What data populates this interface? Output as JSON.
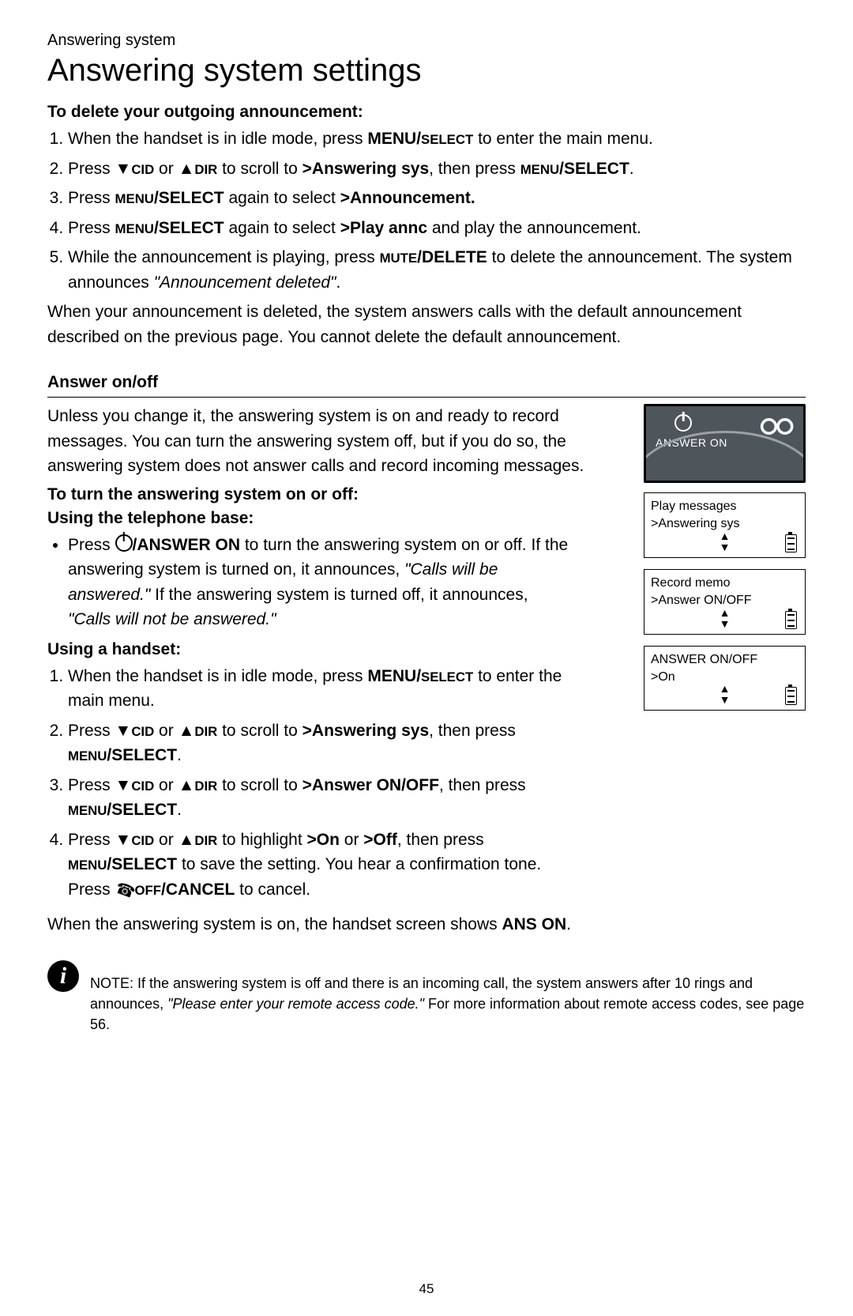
{
  "header": {
    "section": "Answering system"
  },
  "title": "Answering system settings",
  "delete": {
    "heading": "To delete your outgoing announcement:",
    "s1a": "When the handset is in idle mode, press ",
    "s1b": "MENU/",
    "s1c": "SELECT",
    "s1d": " to enter the main menu.",
    "s2a": "Press ",
    "s2down": "▼",
    "s2cid": "CID",
    "s2or": " or ",
    "s2up": "▲",
    "s2dir": "DIR",
    "s2b": " to scroll to ",
    "s2c": ">Answering sys",
    "s2d": ", then press ",
    "s2e": "MENU",
    "s2f": "/SELECT",
    "s2g": ".",
    "s3a": "Press ",
    "s3b": "MENU",
    "s3c": "/SELECT",
    "s3d": " again to select ",
    "s3e": ">Announcement.",
    "s4a": "Press ",
    "s4b": "MENU",
    "s4c": "/SELECT",
    "s4d": " again to select ",
    "s4e": ">Play annc",
    "s4f": " and play the announcement.",
    "s5a": "While the announcement is playing, press ",
    "s5b": "MUTE",
    "s5c": "/DELETE",
    "s5d": " to delete the announcement. The system announces ",
    "s5e": "\"Announcement deleted\"",
    "s5f": ".",
    "after": "When your announcement is deleted, the system answers calls with the default announcement described on the previous page. You cannot delete the default announcement."
  },
  "answer": {
    "heading": "Answer on/off",
    "intro": "Unless you change it, the answering system is on and ready to record messages. You can turn the answering system off, but if you do so, the answering system does not answer calls and record incoming messages.",
    "turn_heading": "To turn the answering system on or off:",
    "base_heading": "Using the telephone base:",
    "b1a": "Press ",
    "b1b": "/ANSWER ON",
    "b1c": " to turn the answering system on or off. If the answering system is turned on, it announces, ",
    "b1d": "\"Calls will be answered.\"",
    "b1e": " If the answering system is turned off, it announces, ",
    "b1f": "\"Calls will not be answered.\"",
    "hs_heading": "Using a handset:",
    "h1a": "When the handset is in idle mode, press ",
    "h1b": "MENU/",
    "h1c": "SELECT",
    "h1d": " to enter the main menu.",
    "h2a": "Press ",
    "h2b": " to scroll to ",
    "h2c": ">Answering sys",
    "h2d": ", then press ",
    "h2e": "MENU",
    "h2f": "/SELECT",
    "h2g": ".",
    "h3a": "Press ",
    "h3b": " to scroll to ",
    "h3c": ">Answer ON/OFF",
    "h3d": ", then press ",
    "h3e": "MENU",
    "h3f": "/SELECT",
    "h3g": ".",
    "h4a": "Press ",
    "h4b": " to highlight ",
    "h4c": ">On",
    "h4d": " or ",
    "h4e": ">Off",
    "h4f": ", then press ",
    "h4g": "MENU",
    "h4h": "/SELECT",
    "h4i": " to save the setting. You hear a confirmation tone.",
    "h4j": "Press ",
    "h4k": "OFF",
    "h4l": "/CANCEL",
    "h4m": " to cancel.",
    "final_a": "When the answering system is on, the handset screen shows ",
    "final_b": "ANS ON",
    "final_c": "."
  },
  "base": {
    "label": "ANSWER ON"
  },
  "lcd1": {
    "l1": "Play messages",
    "l2": ">Answering sys"
  },
  "lcd2": {
    "l1": "Record memo",
    "l2": ">Answer ON/OFF"
  },
  "lcd3": {
    "l1": "ANSWER ON/OFF",
    "l2": ">On"
  },
  "note": {
    "label": "NOTE:",
    "t1": " If the answering system is off and there is an incoming call, the system answers after 10 rings and announces, ",
    "t2": "\"Please enter your remote access code.\"",
    "t3": " For more information about remote access codes, see page 56."
  },
  "pagenum": "45",
  "sym": {
    "down": "▼",
    "up": "▲",
    "cid": "CID",
    "dir": "DIR",
    "or": " or "
  }
}
